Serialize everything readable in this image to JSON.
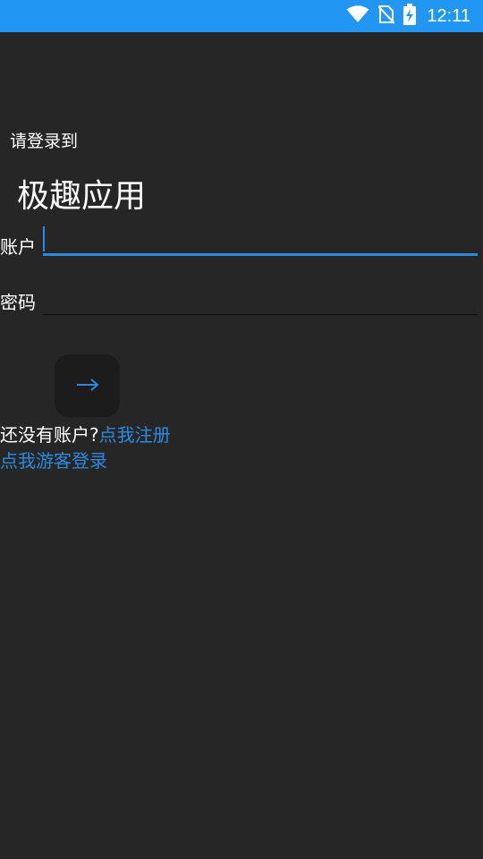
{
  "status_bar": {
    "time": "12:11",
    "icons": [
      "wifi-icon",
      "no-sim-icon",
      "battery-charging-icon"
    ],
    "background": "#2196f3"
  },
  "login": {
    "subtitle": "请登录到",
    "app_title": "极趣应用",
    "account_label": "账户",
    "account_value": "",
    "password_label": "密码",
    "password_value": "",
    "submit_icon": "arrow-right-icon",
    "no_account_text": "还没有账户?",
    "register_link": "点我注册",
    "guest_link": "点我游客登录"
  },
  "colors": {
    "background": "#262626",
    "accent": "#2b8be0",
    "button": "#1c1c1c"
  }
}
